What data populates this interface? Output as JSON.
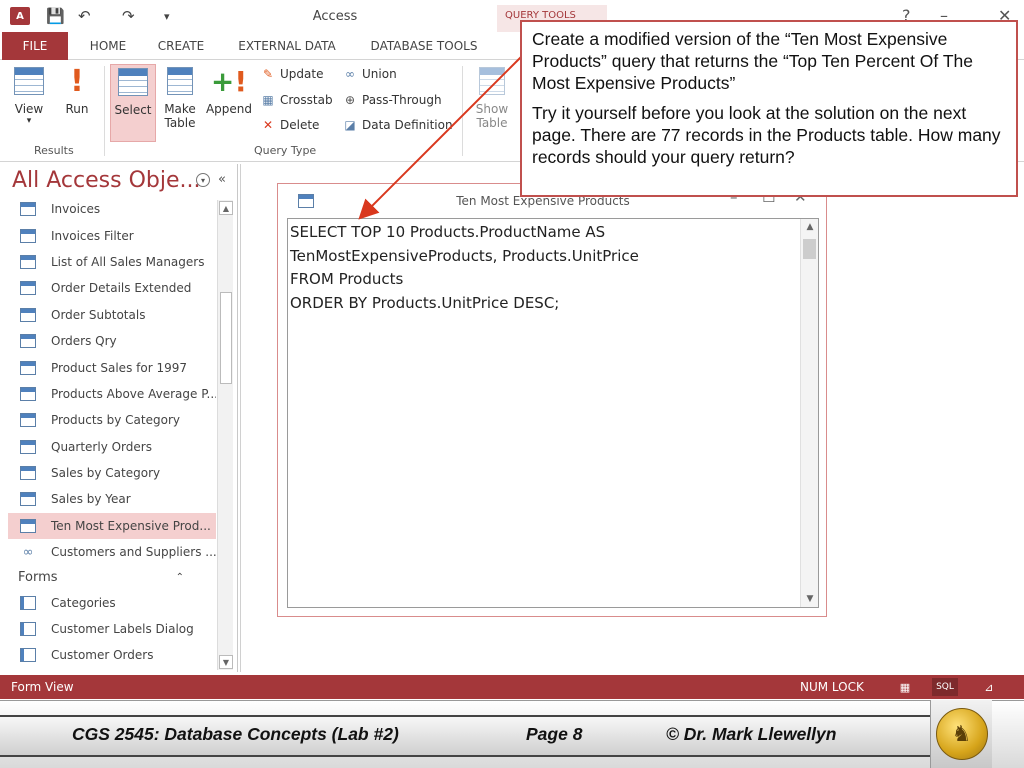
{
  "app": {
    "logo_text": "A",
    "title": "Access",
    "contextual_tab": "QUERY TOOLS",
    "window_controls": [
      "?",
      "–",
      "✕"
    ]
  },
  "ribbon_tabs": [
    "FILE",
    "HOME",
    "CREATE",
    "EXTERNAL DATA",
    "DATABASE TOOLS"
  ],
  "ribbon": {
    "view": "View",
    "run": "Run",
    "select": "Select",
    "make_table_1": "Make",
    "make_table_2": "Table",
    "append": "Append",
    "update": "Update",
    "crosstab": "Crosstab",
    "delete": "Delete",
    "union": "Union",
    "pass_through": "Pass-Through",
    "data_definition": "Data Definition",
    "show_table_1": "Show",
    "show_table_2": "Table",
    "group_results": "Results",
    "group_query_type": "Query Type"
  },
  "nav": {
    "title": "All Access Obje...",
    "queries": [
      "Invoices",
      "Invoices Filter",
      "List of All Sales Managers",
      "Order Details Extended",
      "Order Subtotals",
      "Orders Qry",
      "Product Sales for 1997",
      "Products Above Average P...",
      "Products by Category",
      "Quarterly Orders",
      "Sales by Category",
      "Sales by Year",
      "Ten Most Expensive Prod...",
      "Customers and Suppliers ..."
    ],
    "forms_header": "Forms",
    "forms": [
      "Categories",
      "Customer Labels Dialog",
      "Customer Orders"
    ]
  },
  "sql_window": {
    "title": "Ten Most Expensive Products",
    "sql": "SELECT TOP 10 Products.ProductName AS\nTenMostExpensiveProducts, Products.UnitPrice\nFROM Products\nORDER BY Products.UnitPrice DESC;"
  },
  "callout": {
    "para1": "Create a modified version of the “Ten Most Expensive Products” query that returns the “Top Ten Percent Of The Most Expensive Products”",
    "para2": "Try it yourself before you look at the solution on the next page.  There are 77 records in the Products table.  How many records should your query return?"
  },
  "status": {
    "left": "Form View",
    "numlock": "NUM LOCK",
    "sql_view": "SQL"
  },
  "footer": {
    "course": "CGS 2545: Database Concepts  (Lab #2)",
    "page": "Page 8",
    "author": "© Dr. Mark Llewellyn"
  },
  "colors": {
    "access_accent": "#a4373a",
    "callout_border": "#c0504d"
  }
}
